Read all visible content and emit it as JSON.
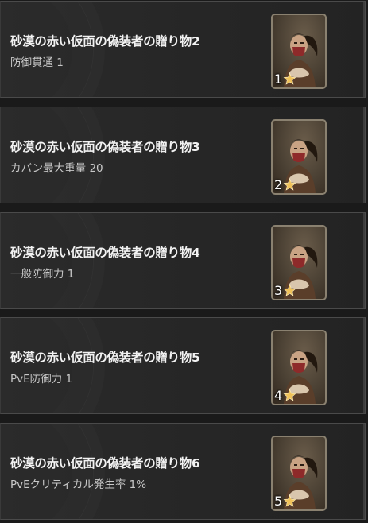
{
  "items": [
    {
      "name": "砂漠の赤い仮面の偽装者の贈り物2",
      "stat": "防御貫通 1",
      "grade": "1"
    },
    {
      "name": "砂漠の赤い仮面の偽装者の贈り物3",
      "stat": "カバン最大重量 20",
      "grade": "2"
    },
    {
      "name": "砂漠の赤い仮面の偽装者の贈り物4",
      "stat": "一般防御力 1",
      "grade": "3"
    },
    {
      "name": "砂漠の赤い仮面の偽装者の贈り物5",
      "stat": "PvE防御力 1",
      "grade": "4"
    },
    {
      "name": "砂漠の赤い仮面の偽装者の贈り物6",
      "stat": "PvEクリティカル発生率 1%",
      "grade": "5"
    }
  ],
  "colors": {
    "background": "#1a1a1a",
    "card": "#2b2b2b",
    "card_border": "#4a4a4a",
    "title_text": "#f2f2f2",
    "stat_text": "#c8c8c8",
    "star": "#f0c25a",
    "portrait_frame": "#8a8170"
  },
  "icons": {
    "portrait": "character-portrait",
    "grade": "star-icon"
  }
}
